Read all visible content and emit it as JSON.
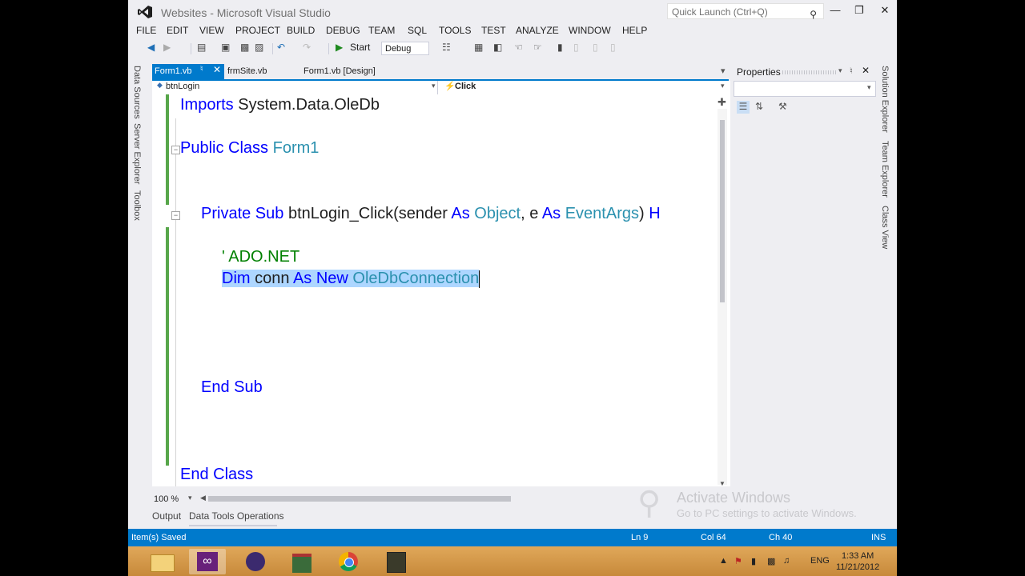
{
  "window": {
    "title": "Websites - Microsoft Visual Studio",
    "quick_launch_placeholder": "Quick Launch (Ctrl+Q)"
  },
  "menu": [
    "FILE",
    "EDIT",
    "VIEW",
    "PROJECT",
    "BUILD",
    "DEBUG",
    "TEAM",
    "SQL",
    "TOOLS",
    "TEST",
    "ANALYZE",
    "WINDOW",
    "HELP"
  ],
  "toolbar": {
    "start_label": "Start",
    "config_value": "Debug"
  },
  "left_tabs": [
    "Data Sources",
    "Server Explorer",
    "Toolbox"
  ],
  "right_tabs": [
    "Solution Explorer",
    "Team Explorer",
    "Class View"
  ],
  "doc_tabs": [
    {
      "label": "Form1.vb",
      "active": true
    },
    {
      "label": "frmSite.vb",
      "active": false
    },
    {
      "label": "Form1.vb [Design]",
      "active": false
    }
  ],
  "nav": {
    "left": "btnLogin",
    "right": "Click"
  },
  "code": {
    "l1_kw": "Imports",
    "l1_rest": " System.Data.OleDb",
    "l2_kw": "Public Class",
    "l2_ty": " Form1",
    "l3_kw1": "Private Sub",
    "l3_a": " btnLogin_Click(sender ",
    "l3_kw2": "As",
    "l3_ty1": " Object",
    "l3_b": ", e ",
    "l3_kw3": "As",
    "l3_ty2": " EventArgs",
    "l3_c": ") ",
    "l3_kw4": "H",
    "l4_comment": "' ADO.NET",
    "l5_kw1": "Dim",
    "l5_a": " conn ",
    "l5_kw2": "As New",
    "l5_ty": " OleDbConnection",
    "l6_kw": "End Sub",
    "l7_kw": "End Class"
  },
  "zoom": "100 %",
  "bottom_tabs": [
    "Output",
    "Data Tools Operations"
  ],
  "properties": {
    "title": "Properties"
  },
  "status": {
    "message": "Item(s) Saved",
    "ln": "Ln 9",
    "col": "Col 64",
    "ch": "Ch 40",
    "mode": "INS"
  },
  "watermark": {
    "line1": "Activate Windows",
    "line2": "Go to PC settings to activate Windows."
  },
  "taskbar": {
    "lang": "ENG",
    "time": "1:33 AM",
    "date": "11/21/2012"
  },
  "colors": {
    "accent": "#007acc",
    "keyword": "#0000ff",
    "type": "#2b91af",
    "comment": "#008000"
  }
}
